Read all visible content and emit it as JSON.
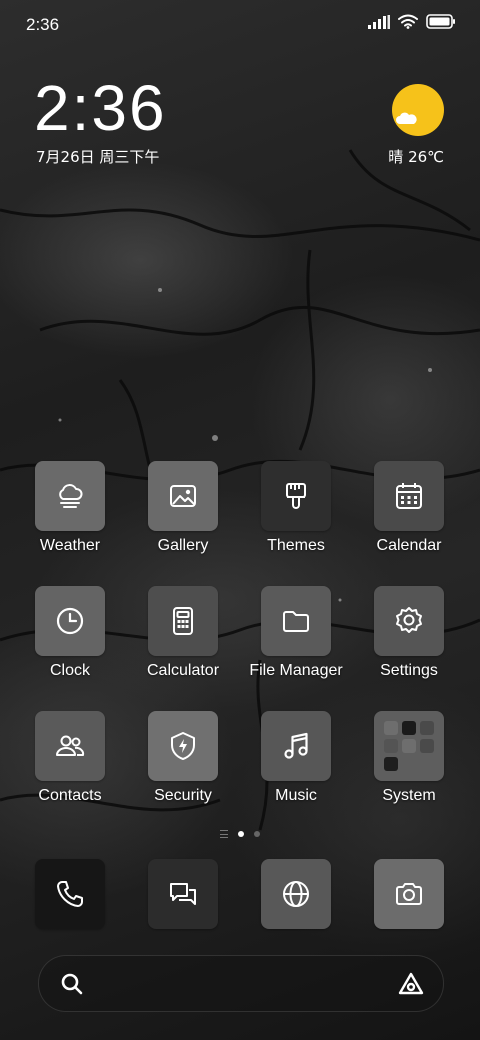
{
  "status_bar": {
    "time": "2:36",
    "signal_icon": "signal-icon",
    "wifi_icon": "wifi-icon",
    "battery_icon": "battery-icon"
  },
  "clock_widget": {
    "time": "2:36",
    "date": "7月26日 周三下午"
  },
  "weather_widget": {
    "icon": "sun-cloud-icon",
    "text": "晴 26℃",
    "sun_color": "#f6c21a"
  },
  "apps": [
    {
      "label": "Weather",
      "icon": "cloud-fog-icon",
      "color": "#6a6a6a"
    },
    {
      "label": "Gallery",
      "icon": "image-icon",
      "color": "#6a6a6a"
    },
    {
      "label": "Themes",
      "icon": "paintbrush-icon",
      "color": "#2e2e2e"
    },
    {
      "label": "Calendar",
      "icon": "calendar-icon",
      "color": "#4a4a4a"
    },
    {
      "label": "Clock",
      "icon": "clock-icon",
      "color": "#646464"
    },
    {
      "label": "Calculator",
      "icon": "calculator-icon",
      "color": "#4e4e4e"
    },
    {
      "label": "File Manager",
      "icon": "folder-icon",
      "color": "#5a5a5a"
    },
    {
      "label": "Settings",
      "icon": "gear-icon",
      "color": "#555555"
    },
    {
      "label": "Contacts",
      "icon": "people-icon",
      "color": "#5a5a5a"
    },
    {
      "label": "Security",
      "icon": "shield-bolt-icon",
      "color": "#707070"
    },
    {
      "label": "Music",
      "icon": "music-note-icon",
      "color": "#575757"
    },
    {
      "label": "System",
      "icon": "folder-grid-icon",
      "color": "#5e5e5e"
    }
  ],
  "page_indicator": {
    "pages": 2,
    "current": 1
  },
  "dock": [
    {
      "name": "Phone",
      "icon": "phone-icon",
      "color": "#161616"
    },
    {
      "name": "Messages",
      "icon": "chat-bubbles-icon",
      "color": "#2c2c2c"
    },
    {
      "name": "Browser",
      "icon": "globe-icon",
      "color": "#585858"
    },
    {
      "name": "Camera",
      "icon": "camera-icon",
      "color": "#6c6c6c"
    }
  ],
  "search_bar": {
    "search_icon": "search-icon",
    "assistant_icon": "assistant-icon"
  }
}
